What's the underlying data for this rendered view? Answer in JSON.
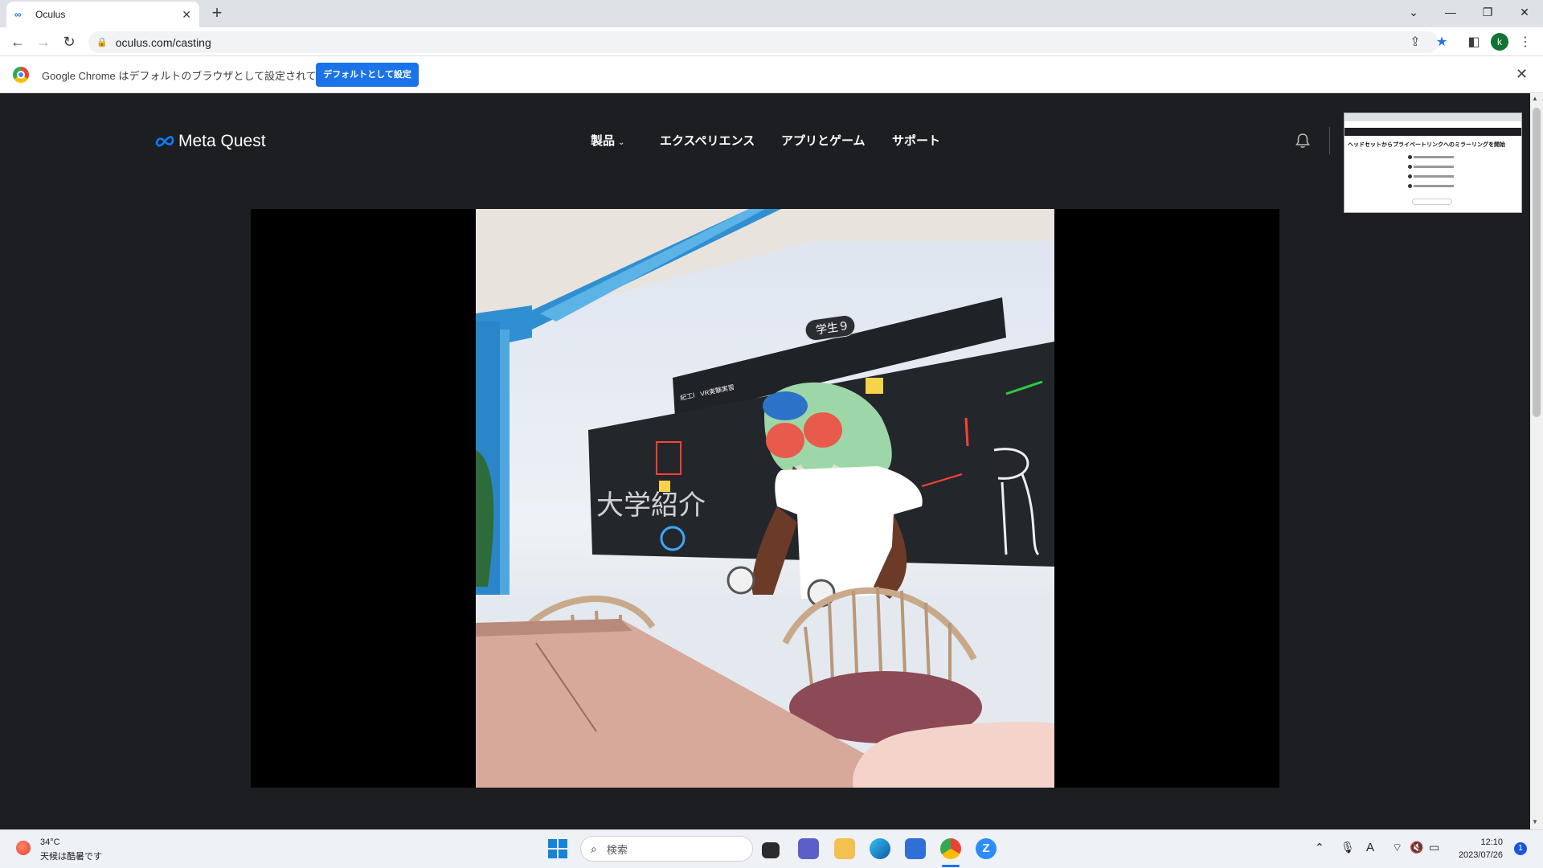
{
  "browser": {
    "tab_title": "Oculus",
    "favicon": "meta-infinity-icon",
    "new_tab_label": "+",
    "url": "oculus.com/casting",
    "profile_initial": "k",
    "infobar_message": "Google Chrome はデフォルトのブラウザとして設定されていません",
    "infobar_button": "デフォルトとして設定",
    "accent": "#1a73e8"
  },
  "site": {
    "logo_text": "Meta Quest",
    "nav": [
      {
        "label": "製品",
        "has_dropdown": true
      },
      {
        "label": "エクスペリエンス",
        "has_dropdown": false
      },
      {
        "label": "アプリとゲーム",
        "has_dropdown": false
      },
      {
        "label": "サポート",
        "has_dropdown": false
      }
    ],
    "background": "#1c1e21"
  },
  "preview_thumbnail": {
    "heading": "ヘッドセットからプライベートリンクへのミラーリングを開始"
  },
  "vr_scene": {
    "name_tag": "学生９",
    "board_sign_left": "紀工Ⅰ",
    "board_sign_right": "VR実験実習",
    "board_writing": "大学紹介"
  },
  "taskbar": {
    "temperature": "34°C",
    "weather": "天候は酷暑です",
    "search_placeholder": "検索",
    "time": "12:10",
    "date": "2023/07/26",
    "notification_count": "1",
    "ime_label": "A"
  }
}
